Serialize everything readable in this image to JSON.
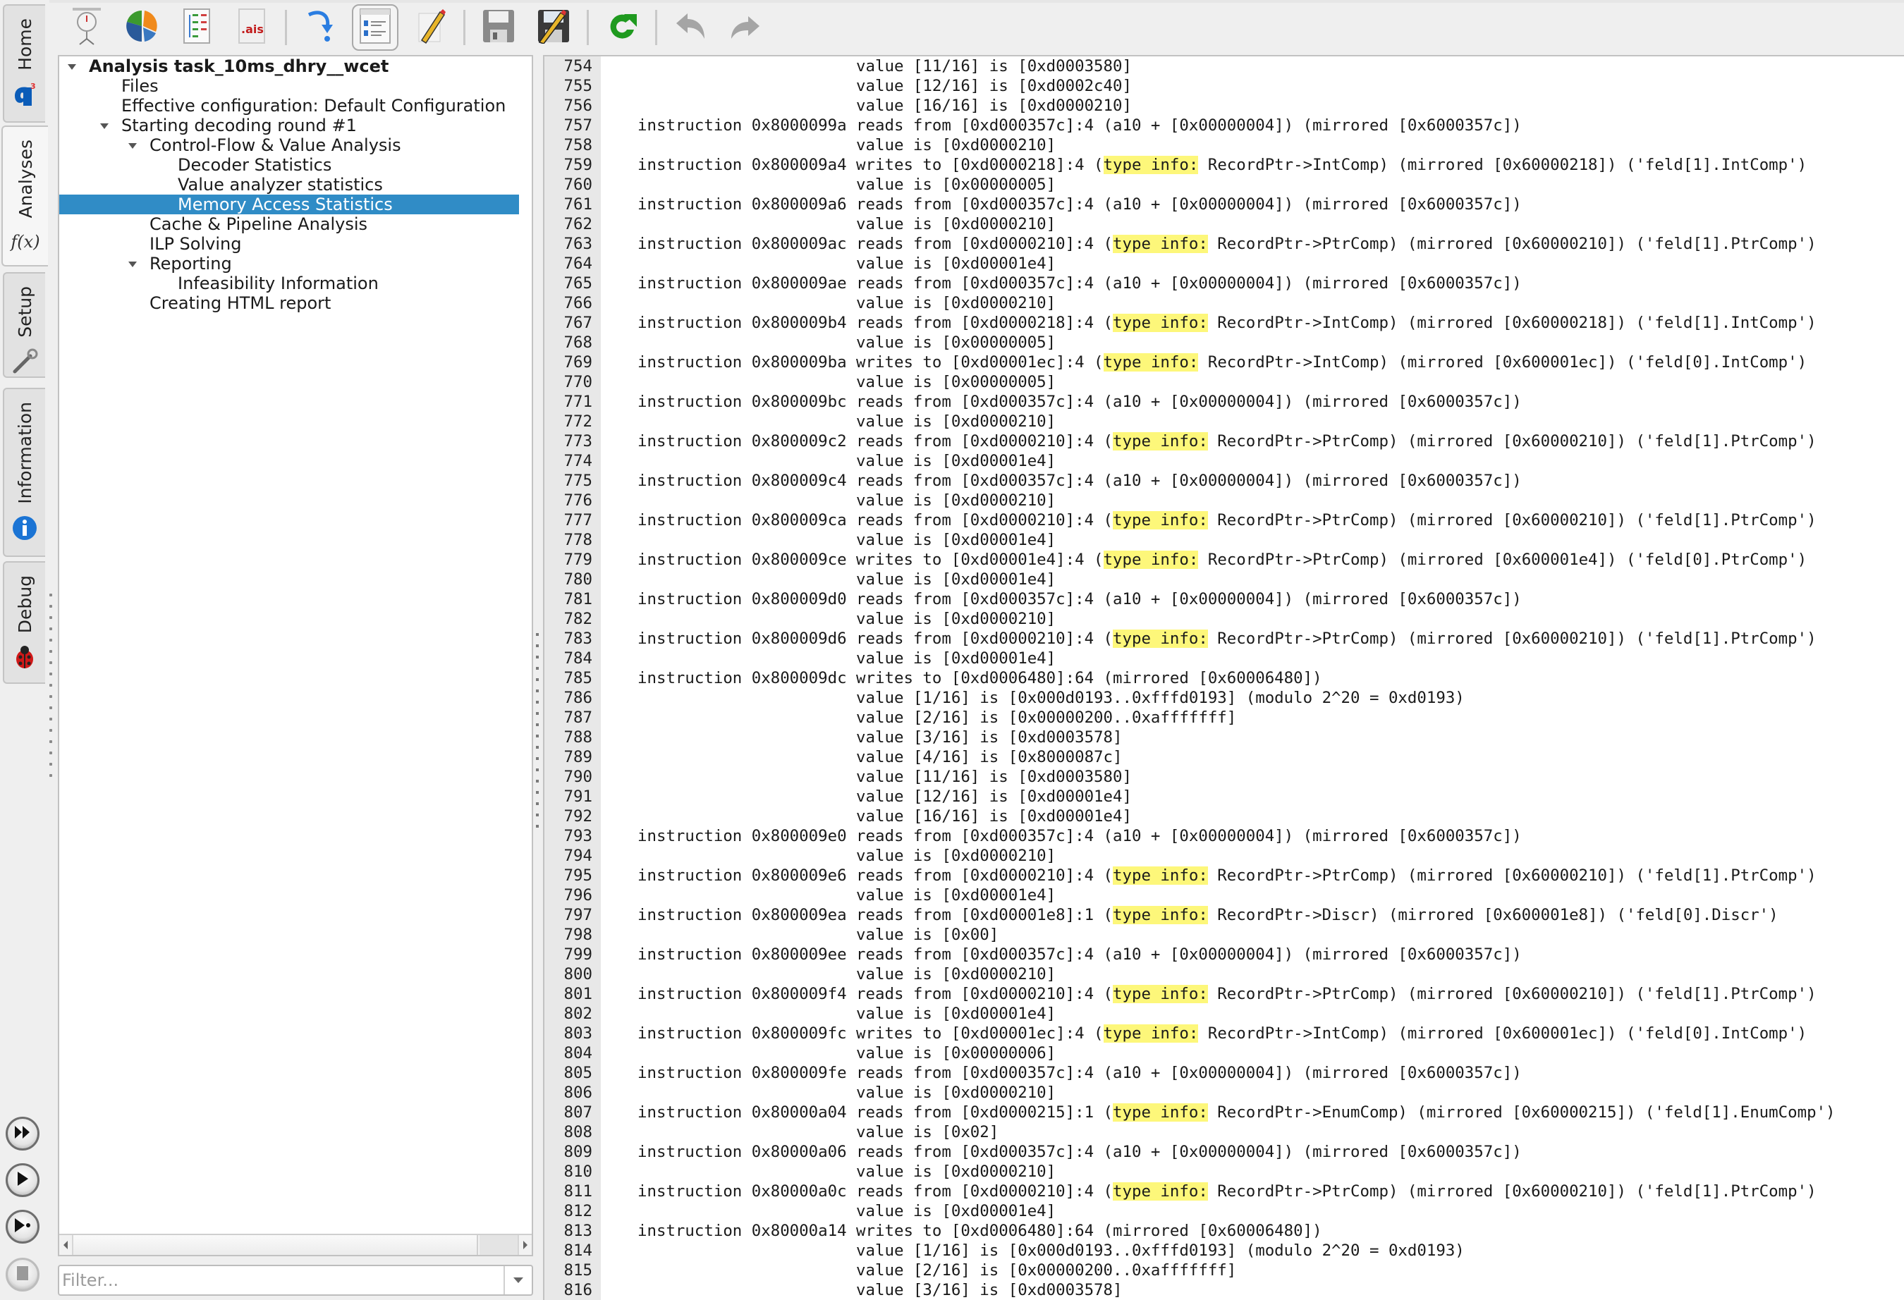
{
  "vertical_tabs": [
    {
      "label": "Home",
      "icon": "a3-logo-icon",
      "active": false
    },
    {
      "label": "Analyses",
      "icon": "function-fx-icon",
      "active": true
    },
    {
      "label": "Setup",
      "icon": "wrench-icon",
      "active": false
    },
    {
      "label": "Information",
      "icon": "info-icon",
      "active": false
    },
    {
      "label": "Debug",
      "icon": "ladybug-icon",
      "active": false
    }
  ],
  "run_controls": [
    {
      "name": "run-all",
      "icon": "fast-forward-icon"
    },
    {
      "name": "run",
      "icon": "play-icon"
    },
    {
      "name": "run-step",
      "icon": "step-play-icon"
    },
    {
      "name": "stop",
      "icon": "stop-icon",
      "disabled": true
    }
  ],
  "toolbar": {
    "buttons": [
      {
        "name": "timing-analysis",
        "icon": "stopwatch-icon"
      },
      {
        "name": "statistics",
        "icon": "pie-chart-icon"
      },
      {
        "name": "tree-view",
        "icon": "tree-list-icon"
      },
      {
        "name": "ais-file",
        "icon": "ais-file-icon",
        "text": ".ais"
      },
      {
        "name": "step-into",
        "icon": "curved-arrow-icon"
      },
      {
        "name": "report-view",
        "icon": "report-view-icon",
        "checked": true
      },
      {
        "name": "edit",
        "icon": "pencil-icon"
      },
      {
        "name": "save",
        "icon": "save-icon"
      },
      {
        "name": "save-as",
        "icon": "save-as-icon"
      },
      {
        "name": "refresh",
        "icon": "refresh-icon"
      },
      {
        "name": "undo",
        "icon": "undo-icon"
      },
      {
        "name": "redo",
        "icon": "redo-icon"
      }
    ]
  },
  "tree": {
    "items": [
      {
        "label": "Analysis task_10ms_dhry__wcet",
        "level": 0,
        "expanded": true,
        "bold": true
      },
      {
        "label": "Files",
        "level": 1
      },
      {
        "label": "Effective configuration: Default Configuration",
        "level": 1
      },
      {
        "label": "Starting decoding round #1",
        "level": 1,
        "expanded": true
      },
      {
        "label": "Control-Flow & Value Analysis",
        "level": 2,
        "expanded": true
      },
      {
        "label": "Decoder Statistics",
        "level": 3
      },
      {
        "label": "Value analyzer statistics",
        "level": 3
      },
      {
        "label": "Memory Access Statistics",
        "level": 3,
        "selected": true
      },
      {
        "label": "Cache & Pipeline Analysis",
        "level": 2
      },
      {
        "label": "ILP Solving",
        "level": 2
      },
      {
        "label": "Reporting",
        "level": 2,
        "expanded": true
      },
      {
        "label": "Infeasibility Information",
        "level": 3
      },
      {
        "label": "Creating HTML report",
        "level": 2
      }
    ],
    "filter_placeholder": "Filter...",
    "filter_value": ""
  },
  "report": {
    "highlight_term": "type info:",
    "highlight_color": "#fdf77a",
    "selection_color": "#308cc6",
    "lines": [
      {
        "n": "754",
        "text": "                       value [11/16] is [0xd0003580]"
      },
      {
        "n": "755",
        "text": "                       value [12/16] is [0xd0002c40]"
      },
      {
        "n": "756",
        "text": "                       value [16/16] is [0xd0000210]"
      },
      {
        "n": "757",
        "text": "instruction 0x8000099a reads from [0xd000357c]:4 (a10 + [0x00000004]) (mirrored [0x6000357c])"
      },
      {
        "n": "758",
        "text": "                       value is [0xd0000210]"
      },
      {
        "n": "759",
        "text": "instruction 0x800009a4 writes to [0xd0000218]:4 (type info: RecordPtr->IntComp) (mirrored [0x60000218]) ('feld[1].IntComp')"
      },
      {
        "n": "760",
        "text": "                       value is [0x00000005]"
      },
      {
        "n": "761",
        "text": "instruction 0x800009a6 reads from [0xd000357c]:4 (a10 + [0x00000004]) (mirrored [0x6000357c])"
      },
      {
        "n": "762",
        "text": "                       value is [0xd0000210]"
      },
      {
        "n": "763",
        "text": "instruction 0x800009ac reads from [0xd0000210]:4 (type info: RecordPtr->PtrComp) (mirrored [0x60000210]) ('feld[1].PtrComp')"
      },
      {
        "n": "764",
        "text": "                       value is [0xd00001e4]"
      },
      {
        "n": "765",
        "text": "instruction 0x800009ae reads from [0xd000357c]:4 (a10 + [0x00000004]) (mirrored [0x6000357c])"
      },
      {
        "n": "766",
        "text": "                       value is [0xd0000210]"
      },
      {
        "n": "767",
        "text": "instruction 0x800009b4 reads from [0xd0000218]:4 (type info: RecordPtr->IntComp) (mirrored [0x60000218]) ('feld[1].IntComp')"
      },
      {
        "n": "768",
        "text": "                       value is [0x00000005]"
      },
      {
        "n": "769",
        "text": "instruction 0x800009ba writes to [0xd00001ec]:4 (type info: RecordPtr->IntComp) (mirrored [0x600001ec]) ('feld[0].IntComp')"
      },
      {
        "n": "770",
        "text": "                       value is [0x00000005]"
      },
      {
        "n": "771",
        "text": "instruction 0x800009bc reads from [0xd000357c]:4 (a10 + [0x00000004]) (mirrored [0x6000357c])"
      },
      {
        "n": "772",
        "text": "                       value is [0xd0000210]"
      },
      {
        "n": "773",
        "text": "instruction 0x800009c2 reads from [0xd0000210]:4 (type info: RecordPtr->PtrComp) (mirrored [0x60000210]) ('feld[1].PtrComp')"
      },
      {
        "n": "774",
        "text": "                       value is [0xd00001e4]"
      },
      {
        "n": "775",
        "text": "instruction 0x800009c4 reads from [0xd000357c]:4 (a10 + [0x00000004]) (mirrored [0x6000357c])"
      },
      {
        "n": "776",
        "text": "                       value is [0xd0000210]"
      },
      {
        "n": "777",
        "text": "instruction 0x800009ca reads from [0xd0000210]:4 (type info: RecordPtr->PtrComp) (mirrored [0x60000210]) ('feld[1].PtrComp')"
      },
      {
        "n": "778",
        "text": "                       value is [0xd00001e4]"
      },
      {
        "n": "779",
        "text": "instruction 0x800009ce writes to [0xd00001e4]:4 (type info: RecordPtr->PtrComp) (mirrored [0x600001e4]) ('feld[0].PtrComp')"
      },
      {
        "n": "780",
        "text": "                       value is [0xd00001e4]"
      },
      {
        "n": "781",
        "text": "instruction 0x800009d0 reads from [0xd000357c]:4 (a10 + [0x00000004]) (mirrored [0x6000357c])"
      },
      {
        "n": "782",
        "text": "                       value is [0xd0000210]"
      },
      {
        "n": "783",
        "text": "instruction 0x800009d6 reads from [0xd0000210]:4 (type info: RecordPtr->PtrComp) (mirrored [0x60000210]) ('feld[1].PtrComp')"
      },
      {
        "n": "784",
        "text": "                       value is [0xd00001e4]"
      },
      {
        "n": "785",
        "text": "instruction 0x800009dc writes to [0xd0006480]:64 (mirrored [0x60006480])"
      },
      {
        "n": "786",
        "text": "                       value [1/16] is [0x000d0193..0xfffd0193] (modulo 2^20 = 0xd0193)"
      },
      {
        "n": "787",
        "text": "                       value [2/16] is [0x00000200..0xafffffff]"
      },
      {
        "n": "788",
        "text": "                       value [3/16] is [0xd0003578]"
      },
      {
        "n": "789",
        "text": "                       value [4/16] is [0x8000087c]"
      },
      {
        "n": "790",
        "text": "                       value [11/16] is [0xd0003580]"
      },
      {
        "n": "791",
        "text": "                       value [12/16] is [0xd00001e4]"
      },
      {
        "n": "792",
        "text": "                       value [16/16] is [0xd00001e4]"
      },
      {
        "n": "793",
        "text": "instruction 0x800009e0 reads from [0xd000357c]:4 (a10 + [0x00000004]) (mirrored [0x6000357c])"
      },
      {
        "n": "794",
        "text": "                       value is [0xd0000210]"
      },
      {
        "n": "795",
        "text": "instruction 0x800009e6 reads from [0xd0000210]:4 (type info: RecordPtr->PtrComp) (mirrored [0x60000210]) ('feld[1].PtrComp')"
      },
      {
        "n": "796",
        "text": "                       value is [0xd00001e4]"
      },
      {
        "n": "797",
        "text": "instruction 0x800009ea reads from [0xd00001e8]:1 (type info: RecordPtr->Discr) (mirrored [0x600001e8]) ('feld[0].Discr')"
      },
      {
        "n": "798",
        "text": "                       value is [0x00]"
      },
      {
        "n": "799",
        "text": "instruction 0x800009ee reads from [0xd000357c]:4 (a10 + [0x00000004]) (mirrored [0x6000357c])"
      },
      {
        "n": "800",
        "text": "                       value is [0xd0000210]"
      },
      {
        "n": "801",
        "text": "instruction 0x800009f4 reads from [0xd0000210]:4 (type info: RecordPtr->PtrComp) (mirrored [0x60000210]) ('feld[1].PtrComp')"
      },
      {
        "n": "802",
        "text": "                       value is [0xd00001e4]"
      },
      {
        "n": "803",
        "text": "instruction 0x800009fc writes to [0xd00001ec]:4 (type info: RecordPtr->IntComp) (mirrored [0x600001ec]) ('feld[0].IntComp')"
      },
      {
        "n": "804",
        "text": "                       value is [0x00000006]"
      },
      {
        "n": "805",
        "text": "instruction 0x800009fe reads from [0xd000357c]:4 (a10 + [0x00000004]) (mirrored [0x6000357c])"
      },
      {
        "n": "806",
        "text": "                       value is [0xd0000210]"
      },
      {
        "n": "807",
        "text": "instruction 0x80000a04 reads from [0xd0000215]:1 (type info: RecordPtr->EnumComp) (mirrored [0x60000215]) ('feld[1].EnumComp')"
      },
      {
        "n": "808",
        "text": "                       value is [0x02]"
      },
      {
        "n": "809",
        "text": "instruction 0x80000a06 reads from [0xd000357c]:4 (a10 + [0x00000004]) (mirrored [0x6000357c])"
      },
      {
        "n": "810",
        "text": "                       value is [0xd0000210]"
      },
      {
        "n": "811",
        "text": "instruction 0x80000a0c reads from [0xd0000210]:4 (type info: RecordPtr->PtrComp) (mirrored [0x60000210]) ('feld[1].PtrComp')"
      },
      {
        "n": "812",
        "text": "                       value is [0xd00001e4]"
      },
      {
        "n": "813",
        "text": "instruction 0x80000a14 writes to [0xd0006480]:64 (mirrored [0x60006480])"
      },
      {
        "n": "814",
        "text": "                       value [1/16] is [0x000d0193..0xfffd0193] (modulo 2^20 = 0xd0193)"
      },
      {
        "n": "815",
        "text": "                       value [2/16] is [0x00000200..0xafffffff]"
      },
      {
        "n": "816",
        "text": "                       value [3/16] is [0xd0003578]"
      }
    ]
  }
}
